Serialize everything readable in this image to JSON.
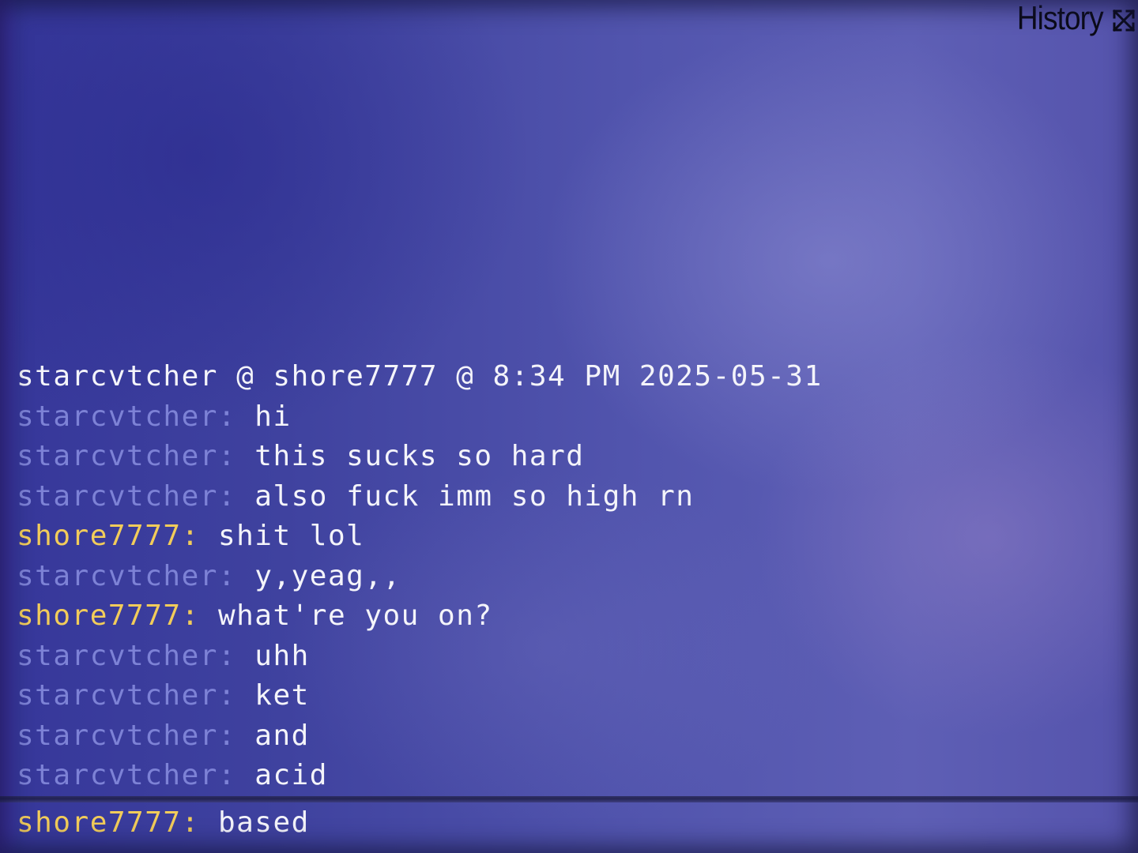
{
  "window": {
    "title": "History",
    "expand_icon": "expand-icon"
  },
  "session_header": "starcvtcher @ shore7777 @ 8:34 PM 2025-05-31",
  "messages": [
    {
      "user": "starcvtcher:",
      "text": "hi"
    },
    {
      "user": "starcvtcher:",
      "text": "this sucks so hard"
    },
    {
      "user": "starcvtcher:",
      "text": "also fuck imm so high rn"
    },
    {
      "user": "shore7777:",
      "text": "shit lol"
    },
    {
      "user": "starcvtcher:",
      "text": "y,yeag,,"
    },
    {
      "user": "shore7777:",
      "text": "what're you on?"
    },
    {
      "user": "starcvtcher:",
      "text": "uhh"
    },
    {
      "user": "starcvtcher:",
      "text": "ket"
    },
    {
      "user": "starcvtcher:",
      "text": "and"
    },
    {
      "user": "starcvtcher:",
      "text": "acid"
    }
  ],
  "input": {
    "user": "shore7777:",
    "text": "based"
  },
  "colors": {
    "self_name": "#7d82d6",
    "other_name": "#f2cc5a",
    "message_text": "#f4f4fa"
  }
}
